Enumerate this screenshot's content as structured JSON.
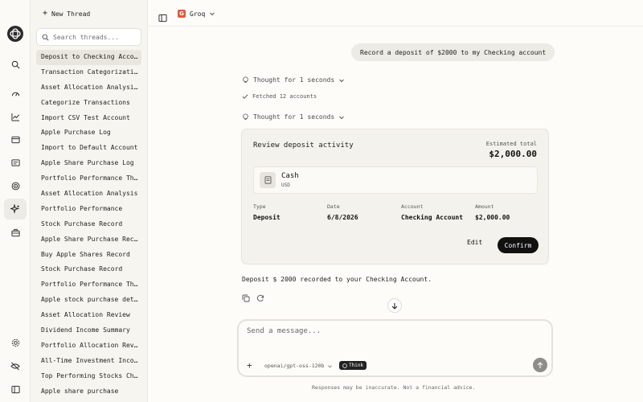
{
  "threads_panel": {
    "new_thread_label": "New Thread",
    "search_placeholder": "Search threads...",
    "items": [
      "Deposit to Checking Account",
      "Transaction Categorization",
      "Asset Allocation Analysis Request",
      "Categorize Transactions",
      "Import CSV Test Account",
      "Apple Purchase Log",
      "Import to Default Account",
      "Apple Share Purchase Log",
      "Portfolio Performance This Month",
      "Asset Allocation Analysis",
      "Portfolio Performance",
      "Stock Purchase Record",
      "Apple Share Purchase Record",
      "Buy Apple Shares Record",
      "Stock Purchase Record",
      "Portfolio Performance This Year",
      "Apple stock purchase details",
      "Asset Allocation Review",
      "Dividend Income Summary",
      "Portfolio Allocation Review",
      "All-Time Investment Income",
      "Top Performing Stocks Check",
      "Apple share purchase"
    ]
  },
  "header": {
    "provider_badge": "G",
    "provider_name": "Groq"
  },
  "conversation": {
    "user_message": "Record a deposit of $2000 to my Checking account",
    "thought_1": "Thought for 1 seconds",
    "fetched": "Fetched 12 accounts",
    "thought_2": "Thought for 1 seconds",
    "review_card": {
      "title": "Review deposit activity",
      "estimated_label": "Estimated total",
      "estimated_value": "$2,000.00",
      "asset_name": "Cash",
      "asset_currency": "USD",
      "type_label": "Type",
      "type_value": "Deposit",
      "date_label": "Date",
      "date_value": "6/8/2026",
      "account_label": "Account",
      "account_value": "Checking Account",
      "amount_label": "Amount",
      "amount_value": "$2,000.00",
      "edit_label": "Edit",
      "confirm_label": "Confirm"
    },
    "result_text": "Deposit $ 2000 recorded to your Checking Account."
  },
  "composer": {
    "placeholder": "Send a message...",
    "model_name": "openai/gpt-oss-120b",
    "think_label": "Think",
    "disclaimer": "Responses may be inaccurate. Not a financial advice."
  },
  "icons": {
    "rail": [
      "logo-icon",
      "search-icon",
      "dashboard-icon",
      "chart-icon",
      "wallet-icon",
      "transactions-icon",
      "target-icon",
      "sparkle-icon",
      "briefcase-icon",
      "settings-icon",
      "privacy-icon",
      "sidebar-toggle-icon"
    ]
  }
}
